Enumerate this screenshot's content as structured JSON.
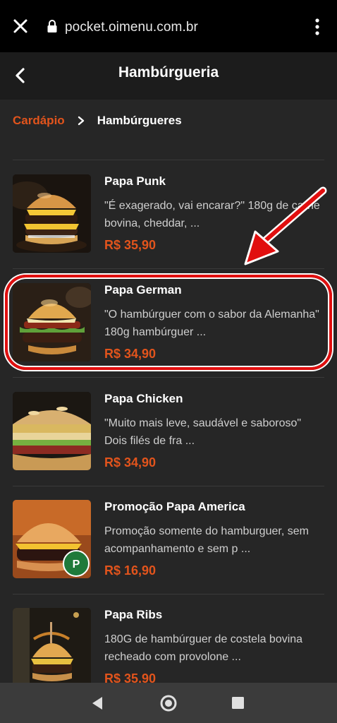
{
  "browser": {
    "url": "pocket.oimenu.com.br"
  },
  "header": {
    "title": "Hambúrgueria"
  },
  "breadcrumb": {
    "root": "Cardápio",
    "current": "Hambúrgueres"
  },
  "colors": {
    "accent": "#e2541c",
    "highlight": "#e10f0f",
    "background": "#262626"
  },
  "icons": [
    "close-icon",
    "lock-icon",
    "more-vert-icon",
    "back-arrow-icon",
    "chevron-right-icon",
    "nav-back-icon",
    "nav-home-icon",
    "nav-recent-icon"
  ],
  "items": [
    {
      "name": "Papa Punk",
      "description": "\"É exagerado, vai encarar?\" 180g de carne bovina, cheddar, ...",
      "price": "R$ 35,90"
    },
    {
      "name": "Papa German",
      "description": "\"O hambúrguer com o sabor da Alemanha\" 180g hambúrguer ...",
      "price": "R$ 34,90"
    },
    {
      "name": "Papa Chicken",
      "description": "\"Muito mais leve, saudável e saboroso\" Dois filés de fra ...",
      "price": "R$ 34,90"
    },
    {
      "name": "Promoção Papa America",
      "description": "Promoção somente do hamburguer, sem acompanhamento e sem p ...",
      "price": "R$ 16,90"
    },
    {
      "name": "Papa Ribs",
      "description": "180G de hambúrguer de costela bovina recheado com provolone ...",
      "price": "R$ 35,90"
    }
  ]
}
